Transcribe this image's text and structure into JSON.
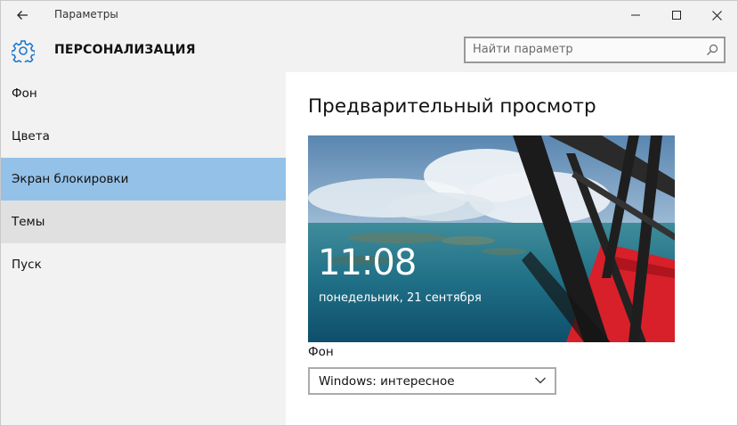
{
  "window": {
    "title": "Параметры",
    "controls": {
      "minimize": "minimize-icon",
      "maximize": "maximize-icon",
      "close": "close-icon"
    }
  },
  "header": {
    "icon": "gear-icon",
    "title": "ПЕРСОНАЛИЗАЦИЯ",
    "search_placeholder": "Найти параметр"
  },
  "sidebar": {
    "items": [
      {
        "label": "Фон",
        "state": "normal"
      },
      {
        "label": "Цвета",
        "state": "normal"
      },
      {
        "label": "Экран блокировки",
        "state": "selected"
      },
      {
        "label": "Темы",
        "state": "hover"
      },
      {
        "label": "Пуск",
        "state": "normal"
      }
    ]
  },
  "main": {
    "title": "Предварительный просмотр",
    "preview": {
      "time": "11:08",
      "date": "понедельник, 21 сентября"
    },
    "background_label": "Фон",
    "background_value": "Windows: интересное"
  },
  "colors": {
    "accent_selected": "#94c1e8",
    "hover": "#e0e0e0",
    "icon_blue": "#1e78c8"
  }
}
